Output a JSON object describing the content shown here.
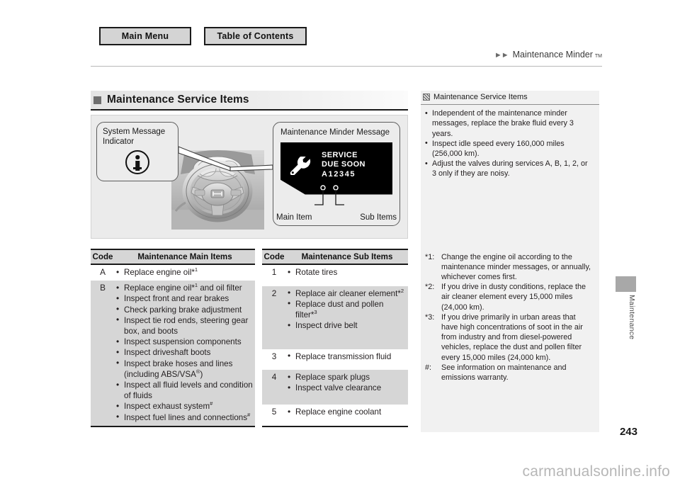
{
  "nav": {
    "main_menu": "Main Menu",
    "table_of_contents": "Table of Contents"
  },
  "breadcrumb": {
    "arrows": "►►",
    "label": "Maintenance Minder",
    "tm": "TM"
  },
  "section": {
    "title": "Maintenance Service Items"
  },
  "illustration": {
    "left_callout": {
      "title": "System Message Indicator",
      "icon": "information-indicator-icon"
    },
    "right_callout": {
      "title": "Maintenance Minder Message",
      "display": {
        "icon": "wrench-icon",
        "line1": "SERVICE",
        "line2": "DUE SOON",
        "code": "A12345"
      },
      "label_main": "Main Item",
      "label_sub": "Sub Items"
    },
    "vehicle": "steering-wheel-illustration"
  },
  "tables": {
    "main": {
      "headers": [
        "Code",
        "Maintenance Main Items"
      ],
      "rows": [
        {
          "code": "A",
          "shaded": false,
          "items": [
            {
              "text": "Replace engine oil*",
              "sup": "1"
            }
          ]
        },
        {
          "code": "B",
          "shaded": true,
          "items": [
            {
              "text": "Replace engine oil*",
              "sup": "1",
              "tail": " and oil filter"
            },
            {
              "text": "Inspect front and rear brakes"
            },
            {
              "text": "Check parking brake adjustment"
            },
            {
              "text": "Inspect tie rod ends, steering gear box, and boots"
            },
            {
              "text": "Inspect suspension components"
            },
            {
              "text": "Inspect driveshaft boots"
            },
            {
              "text": "Inspect brake hoses and lines (including ABS/VSA",
              "sup": "®",
              "tail": ")"
            },
            {
              "text": "Inspect all fluid levels and condition of fluids"
            },
            {
              "text": "Inspect exhaust system",
              "sup": "#"
            },
            {
              "text": "Inspect fuel lines and connections",
              "sup": "#"
            }
          ]
        }
      ]
    },
    "sub": {
      "headers": [
        "Code",
        "Maintenance Sub Items"
      ],
      "rows": [
        {
          "code": "1",
          "shaded": false,
          "items": [
            {
              "text": "Rotate tires"
            }
          ]
        },
        {
          "code": "2",
          "shaded": true,
          "items": [
            {
              "text": "Replace air cleaner element*",
              "sup": "2"
            },
            {
              "text": "Replace dust and pollen filter*",
              "sup": "3"
            },
            {
              "text": "Inspect drive belt"
            }
          ]
        },
        {
          "code": "3",
          "shaded": false,
          "items": [
            {
              "text": "Replace transmission fluid"
            }
          ]
        },
        {
          "code": "4",
          "shaded": true,
          "items": [
            {
              "text": "Replace spark plugs"
            },
            {
              "text": "Inspect valve clearance"
            }
          ]
        },
        {
          "code": "5",
          "shaded": false,
          "items": [
            {
              "text": "Replace engine coolant"
            }
          ]
        }
      ]
    }
  },
  "sidebar": {
    "title": "Maintenance Service Items",
    "notes": [
      "Independent of the maintenance minder messages, replace the brake fluid every 3 years.",
      "Inspect idle speed every 160,000 miles (256,000 km).",
      "Adjust the valves during services A, B, 1, 2, or 3 only if they are noisy."
    ],
    "footnotes": [
      {
        "key": "*1:",
        "text": "Change the engine oil according to the maintenance minder messages, or annually, whichever comes first."
      },
      {
        "key": "*2:",
        "text": "If you drive in dusty conditions, replace the air cleaner element every 15,000 miles (24,000 km)."
      },
      {
        "key": "*3:",
        "text": "If you drive primarily in urban areas that have high concentrations of soot in the air from industry and from diesel-powered vehicles, replace the dust and pollen filter every 15,000 miles (24,000 km)."
      },
      {
        "key": "#:",
        "text": "See information on maintenance and emissions warranty."
      }
    ]
  },
  "edge_tab": {
    "label": "Maintenance"
  },
  "footer": {
    "page_number": "243",
    "watermark": "carmanualsonline.info"
  }
}
